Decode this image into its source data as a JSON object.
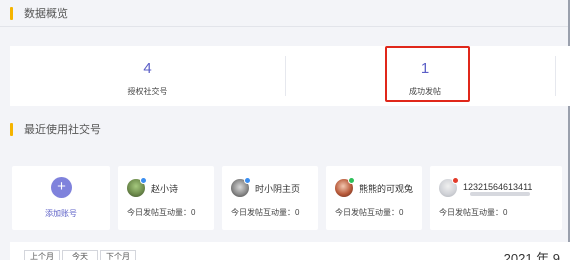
{
  "sections": {
    "overview_title": "数据概览",
    "recent_title": "最近使用社交号"
  },
  "overview": {
    "stats": [
      {
        "value": "4",
        "label": "授权社交号"
      },
      {
        "value": "1",
        "label": "成功发帖"
      }
    ]
  },
  "add_account": {
    "label": "添加账号",
    "icon": "plus-icon"
  },
  "accounts": [
    {
      "name": "赵小诗",
      "stat": "今日发帖互动量：0",
      "badge": "verified-icon",
      "badge_color": "#3b8ef0"
    },
    {
      "name": "时小阴主页",
      "stat": "今日发帖互动量：0",
      "badge": "verified-icon",
      "badge_color": "#3b8ef0"
    },
    {
      "name": "熊熊的可观兔",
      "stat": "今日发帖互动量：0",
      "badge": "wechat-icon",
      "badge_color": "#2dc05a"
    },
    {
      "name": "12321564613411",
      "stat": "今日发帖互动量：0",
      "badge": "weibo-icon",
      "badge_color": "#e23b2a"
    }
  ],
  "bottom": {
    "tabs": [
      "上个月",
      "今天",
      "下个月"
    ],
    "year_label": "2021 年 9"
  },
  "colors": {
    "accent": "#5b5fc7",
    "section_bar": "#f5b400",
    "highlight": "#e0271a"
  }
}
